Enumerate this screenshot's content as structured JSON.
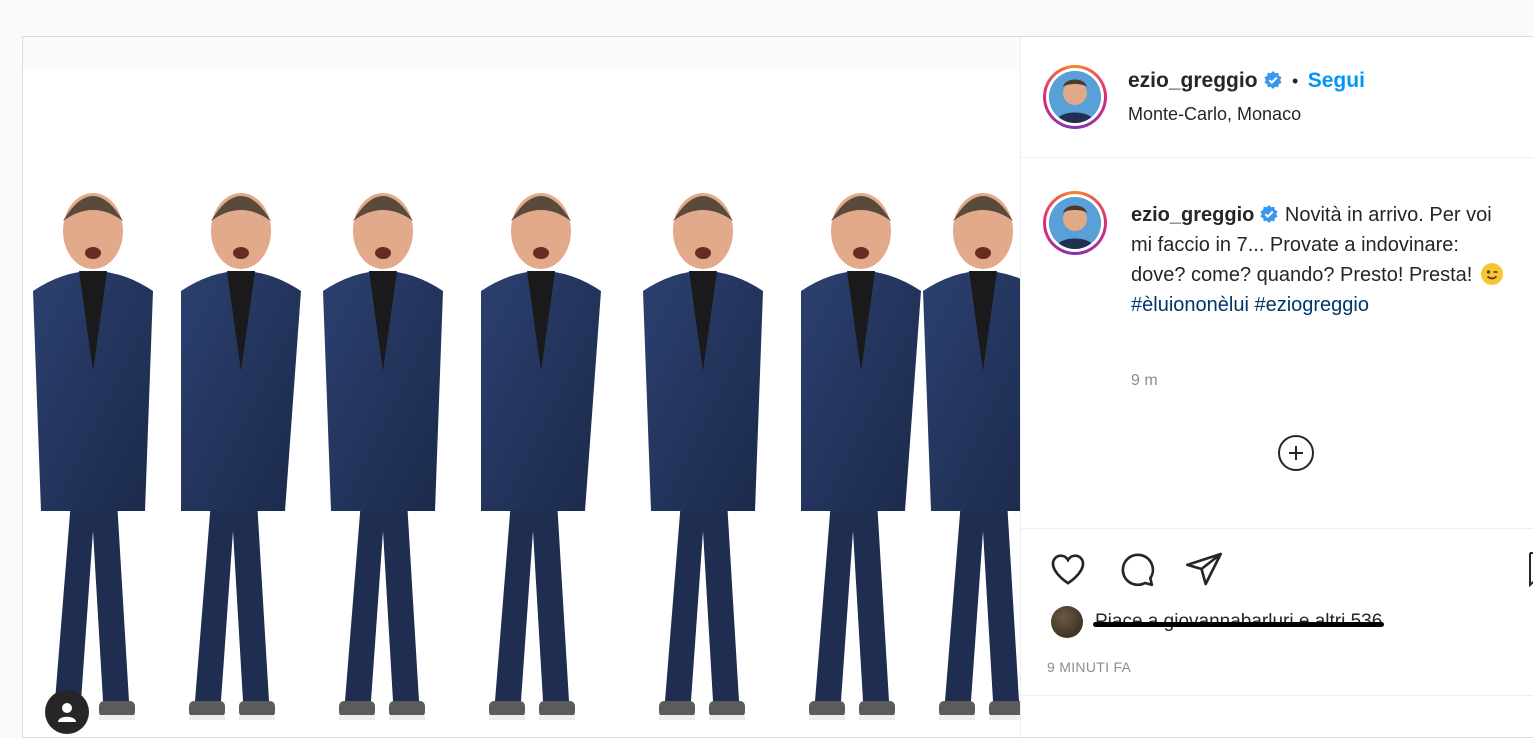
{
  "post": {
    "username": "ezio_greggio",
    "separator": "•",
    "follow_label": "Segui",
    "location": "Monte-Carlo, Monaco",
    "caption": {
      "username": "ezio_greggio",
      "text": "Novità in arrivo. Per voi mi faccio in 7... Provate a indovinare: dove? come? quando? Presto! Presta!",
      "emoji": "winking-face",
      "hashtags": [
        "#èluiononèlui",
        "#eziogreggio"
      ],
      "time": "9 m"
    },
    "likes_text": "Piace a giovannabarluri e altri 536",
    "time_ago": "9 MINUTI FA"
  },
  "colors": {
    "link_blue": "#0095f6",
    "hashtag_blue": "#00376b",
    "suit_navy": "#223355",
    "verified_blue": "#3897f0"
  },
  "icons": {
    "like": "heart-icon",
    "comment": "comment-icon",
    "share": "paper-plane-icon",
    "save": "bookmark-icon",
    "add": "plus-circle-icon",
    "tag": "user-tag-icon"
  }
}
